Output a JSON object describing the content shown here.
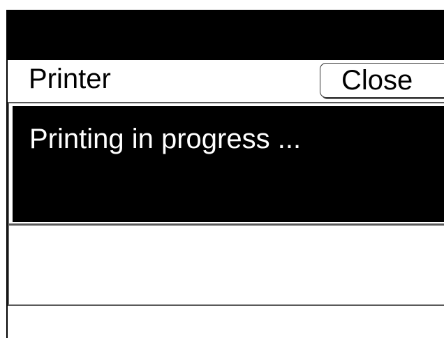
{
  "dialog": {
    "title": "Printer",
    "close_label": "Close",
    "message": "Printing in progress ..."
  },
  "colors": {
    "title_bar": "#000000",
    "message_background": "#000000",
    "message_text": "#ffffff",
    "background": "#ffffff"
  }
}
